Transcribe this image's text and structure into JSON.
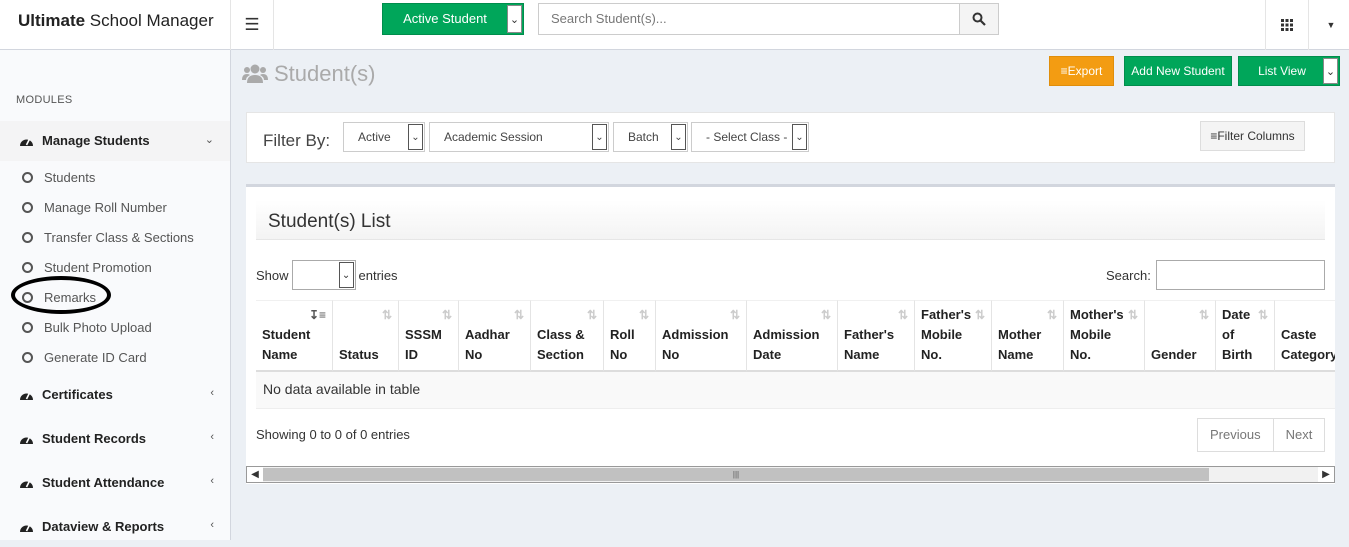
{
  "header": {
    "brand_bold": "Ultimate",
    "brand_rest": " School Manager",
    "active_select_label": "Active Student",
    "search_placeholder": "Search Student(s)..."
  },
  "sidebar": {
    "section_label": "MODULES",
    "manage_students": "Manage Students",
    "sub_items": [
      "Students",
      "Manage Roll Number",
      "Transfer Class & Sections",
      "Student Promotion",
      "Remarks",
      "Bulk Photo Upload",
      "Generate ID Card"
    ],
    "other_menus": [
      "Certificates",
      "Student Records",
      "Student Attendance",
      "Dataview & Reports"
    ]
  },
  "page": {
    "title": "Student(s)",
    "export_label": "Export",
    "add_label": "Add New Student",
    "listview_label": "List View"
  },
  "filter": {
    "label": "Filter By:",
    "status": "Active",
    "session": "Academic Session",
    "batch": "Batch",
    "class": "- Select Class -",
    "columns_label": "Filter Columns"
  },
  "list": {
    "title": "Student(s) List",
    "show_label": "Show",
    "entries_label": "entries",
    "search_label": "Search:",
    "columns": [
      {
        "l1": "",
        "l2": "Student",
        "l3": "Name"
      },
      {
        "l1": "",
        "l2": "",
        "l3": "Status"
      },
      {
        "l1": "",
        "l2": "SSSM",
        "l3": "ID"
      },
      {
        "l1": "",
        "l2": "Aadhar",
        "l3": "No"
      },
      {
        "l1": "",
        "l2": "Class &",
        "l3": "Section"
      },
      {
        "l1": "",
        "l2": "Roll",
        "l3": "No"
      },
      {
        "l1": "",
        "l2": "Admission",
        "l3": "No"
      },
      {
        "l1": "",
        "l2": "Admission",
        "l3": "Date"
      },
      {
        "l1": "",
        "l2": "Father's",
        "l3": "Name"
      },
      {
        "l1": "Father's",
        "l2": "Mobile",
        "l3": "No."
      },
      {
        "l1": "",
        "l2": "Mother",
        "l3": "Name"
      },
      {
        "l1": "Mother's",
        "l2": "Mobile",
        "l3": "No."
      },
      {
        "l1": "",
        "l2": "",
        "l3": "Gender"
      },
      {
        "l1": "Date",
        "l2": "of",
        "l3": "Birth"
      },
      {
        "l1": "",
        "l2": "Caste",
        "l3": "Category"
      }
    ],
    "empty_text": "No data available in table",
    "info_text": "Showing 0 to 0 of 0 entries",
    "prev_label": "Previous",
    "next_label": "Next"
  }
}
